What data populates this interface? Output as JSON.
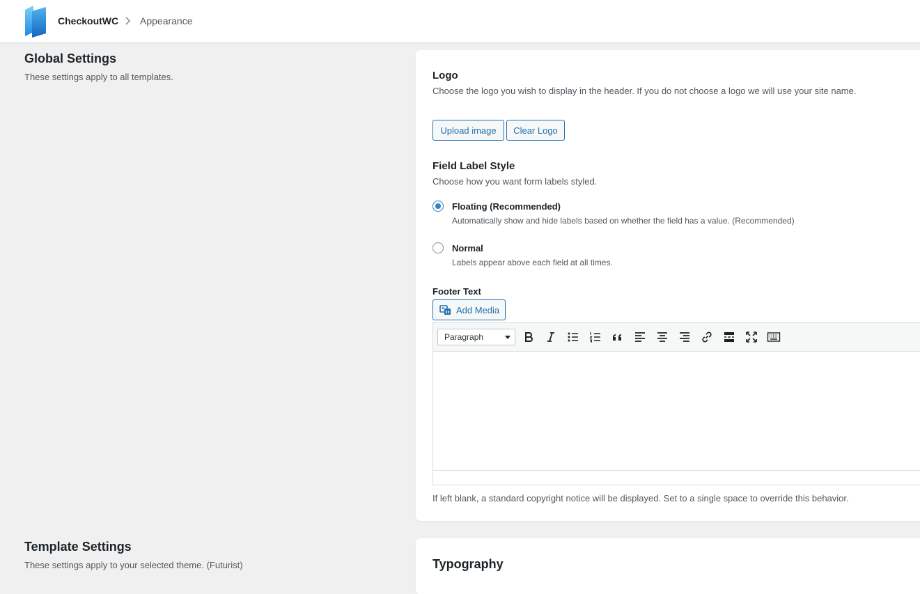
{
  "header": {
    "brand": "CheckoutWC",
    "breadcrumb_current": "Appearance"
  },
  "global": {
    "title": "Global Settings",
    "description": "These settings apply to all templates."
  },
  "logo": {
    "title": "Logo",
    "description": "Choose the logo you wish to display in the header. If you do not choose a logo we will use your site name.",
    "upload_label": "Upload image",
    "clear_label": "Clear Logo"
  },
  "label_style": {
    "title": "Field Label Style",
    "description": "Choose how you want form labels styled.",
    "options": [
      {
        "label": "Floating (Recommended)",
        "description": "Automatically show and hide labels based on whether the field has a value. (Recommended)",
        "checked": true
      },
      {
        "label": "Normal",
        "description": "Labels appear above each field at all times.",
        "checked": false
      }
    ]
  },
  "footer": {
    "title": "Footer Text",
    "add_media_label": "Add Media",
    "format_select": "Paragraph",
    "toolbar_icons": [
      "bold-icon",
      "italic-icon",
      "bullet-list-icon",
      "numbered-list-icon",
      "blockquote-icon",
      "align-left-icon",
      "align-center-icon",
      "align-right-icon",
      "link-icon",
      "read-more-icon",
      "fullscreen-icon",
      "toolbar-toggle-icon"
    ],
    "content": "",
    "help": "If left blank, a standard copyright notice will be displayed. Set to a single space to override this behavior."
  },
  "template": {
    "title": "Template Settings",
    "description": "These settings apply to your selected theme. (Futurist)"
  },
  "typography": {
    "title": "Typography"
  },
  "colors": {
    "accent": "#2271b1",
    "radio_checked": "#3582c4",
    "background": "#f0f0f1"
  }
}
